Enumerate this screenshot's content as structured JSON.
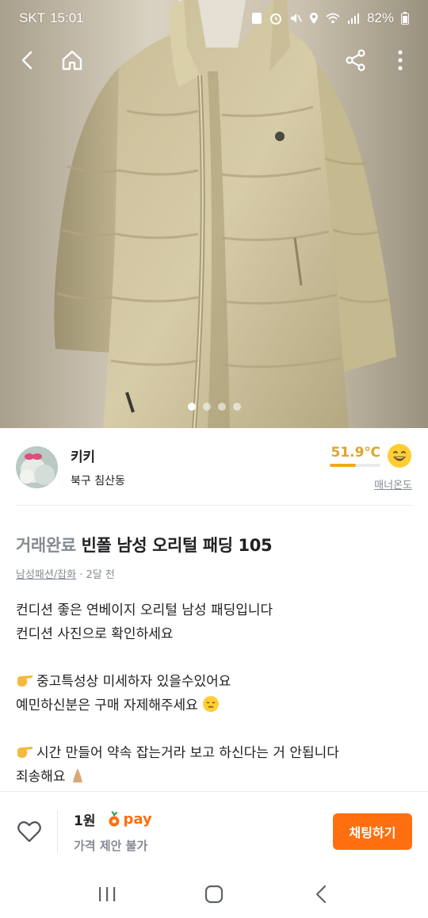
{
  "status_bar": {
    "carrier": "SKT",
    "time": "15:01",
    "battery": "82%"
  },
  "top_nav": {
    "icons": [
      "back-arrow-icon",
      "home-icon",
      "share-icon",
      "more-vertical-icon"
    ]
  },
  "carousel": {
    "page_count": 4,
    "active_index": 0
  },
  "seller": {
    "name": "키키",
    "location": "북구 침산동",
    "temperature": "51.9℃",
    "temperature_percent": 51.9,
    "manner_label": "매너온도"
  },
  "product": {
    "status": "거래완료",
    "title": "빈폴 남성 오리털 패딩 105",
    "category": "남성패션/잡화",
    "time": "· 2달 전",
    "description": [
      "컨디션 좋은 연베이지 오리털 남성 패딩입니다",
      "컨디션 사진으로 확인하세요",
      "",
      "중고특성상 미세하자 있을수있어요",
      "예민하신분은 구매 자제해주세요",
      "",
      "시간 만들어 약속 잡는거라 보고 하신다는 거 안됩니다",
      "죄송해요"
    ]
  },
  "bottom_bar": {
    "price": "1원",
    "pay_label": "pay",
    "negotiation": "가격 제안 불가",
    "chat_button": "채팅하기"
  },
  "colors": {
    "brand_orange": "#ff6f0f",
    "temperature_yellow": "#e0a32a",
    "muted_gray": "#868b94"
  }
}
